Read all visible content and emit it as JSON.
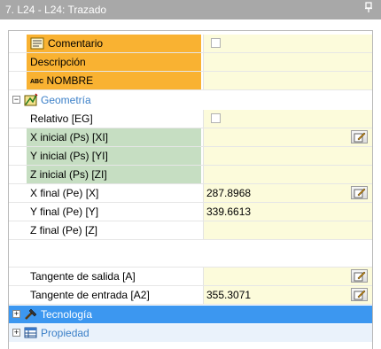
{
  "window": {
    "title": "7. L24 - L24: Trazado",
    "pin_glyph": "ᵖ"
  },
  "rows_top": [
    {
      "label": "Comentario",
      "style": "orange",
      "has_icon": "comment-icon",
      "value_type": "checkbox"
    },
    {
      "label": "Descripción",
      "style": "orange",
      "value_type": "text",
      "value": ""
    },
    {
      "label": "NOMBRE",
      "style": "orange",
      "prefix": "ABC",
      "value_type": "text",
      "value": ""
    }
  ],
  "categories": {
    "geometria": "Geometría",
    "tecnologia": "Tecnología",
    "propiedad": "Propiedad"
  },
  "geometry_rows": [
    {
      "label": "Relativo [EG]",
      "value_type": "checkbox"
    },
    {
      "label": "X inicial (Ps) [XI]",
      "style": "green",
      "value": "",
      "button": true
    },
    {
      "label": "Y inicial (Ps) [YI]",
      "style": "green",
      "value": ""
    },
    {
      "label": "Z inicial (Ps) [ZI]",
      "style": "green",
      "value": ""
    },
    {
      "label": "X final (Pe) [X]",
      "value": "287.8968",
      "button": true
    },
    {
      "label": "Y final (Pe) [Y]",
      "value": "339.6613"
    },
    {
      "label": "Z final (Pe) [Z]",
      "value": ""
    },
    {
      "label": "",
      "value": ""
    },
    {
      "label": "Tangente de salida [A]",
      "value": "",
      "button": true
    },
    {
      "label": "Tangente de entrada [A2]",
      "value": "355.3071",
      "button": true
    }
  ],
  "colors": {
    "orange": "#f9b232",
    "green": "#c6dec2",
    "value_bg": "#fcfbdb",
    "category_blue": "#3c97f0",
    "titlebar": "#a8a8a8"
  }
}
